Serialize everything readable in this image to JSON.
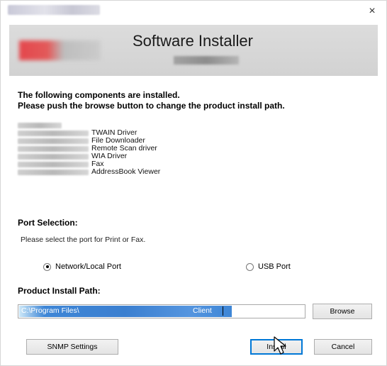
{
  "window": {
    "close_glyph": "×"
  },
  "header": {
    "title": "Software Installer"
  },
  "intro": {
    "line1": "The following components are installed.",
    "line2": "Please push the browse button to change the product install path."
  },
  "components": [
    {
      "name": ""
    },
    {
      "name": "TWAIN Driver"
    },
    {
      "name": "File Downloader"
    },
    {
      "name": "Remote Scan driver"
    },
    {
      "name": "WIA Driver"
    },
    {
      "name": "Fax"
    },
    {
      "name": "AddressBook Viewer"
    }
  ],
  "port": {
    "label": "Port Selection:",
    "help": "Please select the port for Print or Fax.",
    "options": [
      {
        "label": "Network/Local Port",
        "selected": true
      },
      {
        "label": "USB Port",
        "selected": false
      }
    ]
  },
  "install_path": {
    "label": "Product Install Path:",
    "value_left": "C:\\Program Files\\",
    "value_right": "Client"
  },
  "buttons": {
    "browse": "Browse",
    "snmp": "SNMP Settings",
    "install": "Install",
    "cancel": "Cancel"
  },
  "icons": {
    "close": "close-icon",
    "radio_selected": "radio-selected-icon",
    "radio_unselected": "radio-unselected-icon",
    "cursor": "mouse-pointer-icon"
  },
  "colors": {
    "selection": "#3b7fd0",
    "focus_border": "#0078d7",
    "header_bg": "#d6d6d6"
  }
}
